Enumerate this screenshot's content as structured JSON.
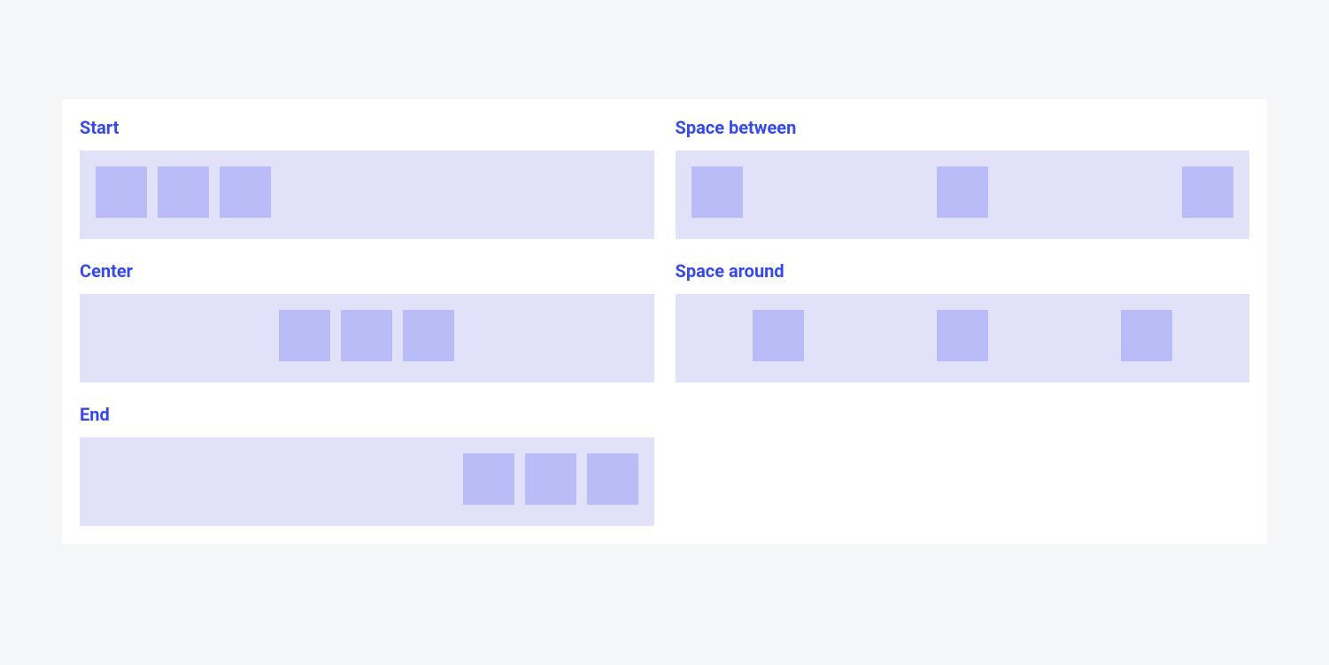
{
  "examples": {
    "start": {
      "title": "Start"
    },
    "center": {
      "title": "Center"
    },
    "end": {
      "title": "End"
    },
    "between": {
      "title": "Space between"
    },
    "around": {
      "title": "Space around"
    }
  }
}
